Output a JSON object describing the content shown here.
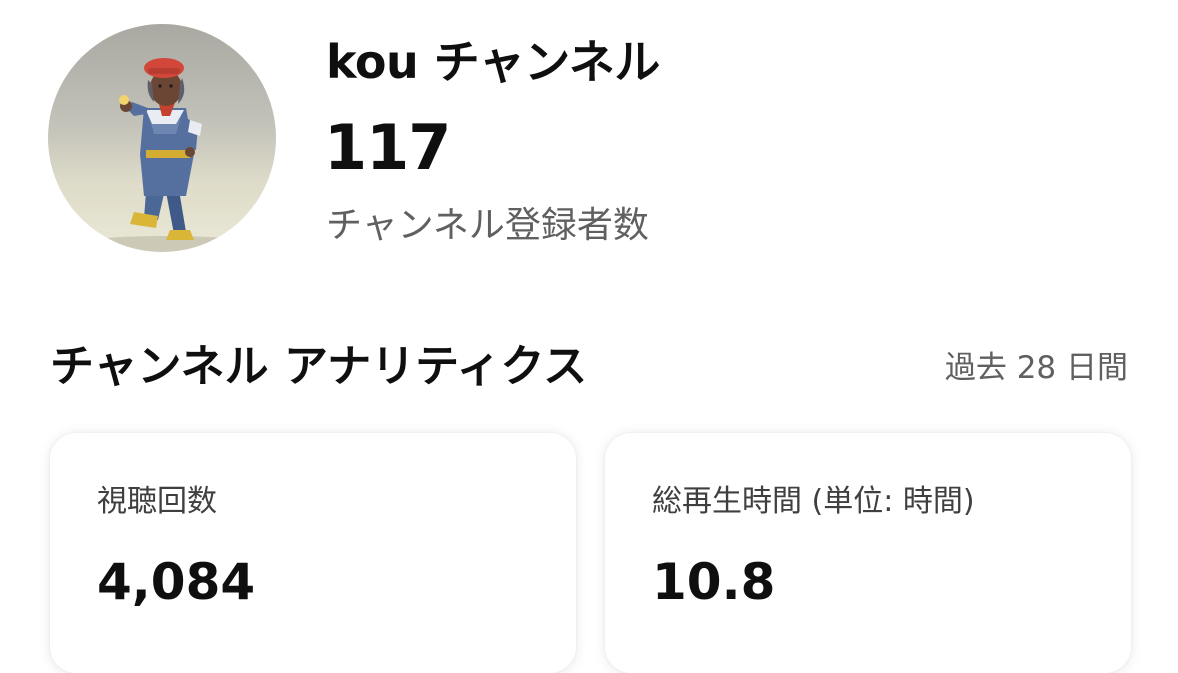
{
  "channel": {
    "name": "kou チャンネル",
    "subscriber_count": "117",
    "subscriber_label": "チャンネル登録者数"
  },
  "analytics": {
    "title": "チャンネル アナリティクス",
    "period": "過去 28 日間",
    "cards": [
      {
        "label": "視聴回数",
        "value": "4,084"
      },
      {
        "label": "総再生時間 (単位: 時間)",
        "value": "10.8"
      }
    ]
  }
}
